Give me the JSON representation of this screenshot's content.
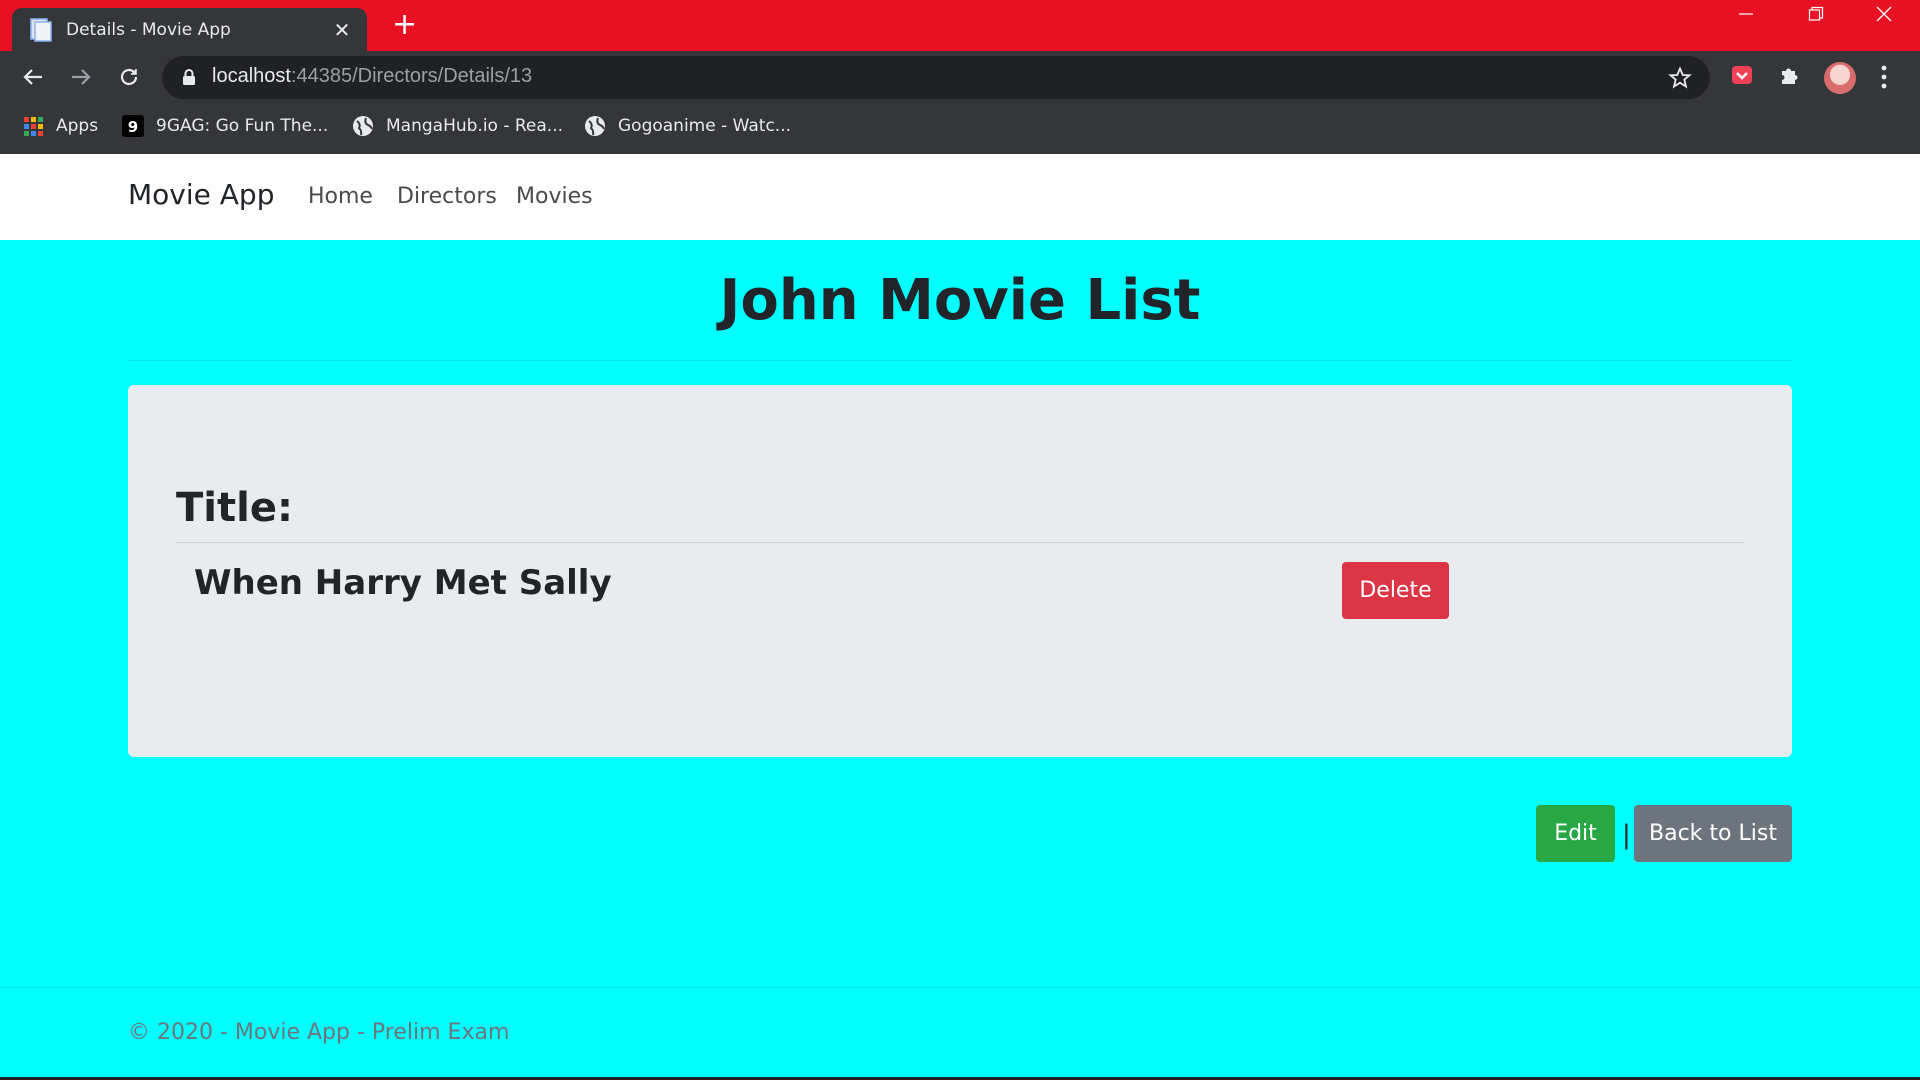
{
  "browser": {
    "tab_title": "Details - Movie App",
    "tab_close": "✕",
    "new_tab": "+",
    "url_host": "localhost",
    "url_rest": ":44385/Directors/Details/13",
    "bookmarks": [
      {
        "label": "Apps"
      },
      {
        "label": "9GAG: Go Fun The..."
      },
      {
        "label": "MangaHub.io - Rea..."
      },
      {
        "label": "Gogoanime - Watc..."
      }
    ]
  },
  "navbar": {
    "brand": "Movie App",
    "links": [
      "Home",
      "Directors",
      "Movies"
    ]
  },
  "page": {
    "heading": "John Movie List",
    "title_label": "Title:",
    "movie_title": "When Harry Met Sally",
    "delete_label": "Delete",
    "edit_label": "Edit",
    "separator": "|",
    "back_label": "Back to List"
  },
  "footer": {
    "text": "© 2020 - Movie App - Prelim Exam"
  },
  "colors": {
    "page_background": "#00ffff",
    "tabstrip": "#e81123",
    "delete": "#dc3545",
    "edit": "#28a745",
    "back": "#6c757d"
  },
  "icons": [
    "page-icon",
    "back-arrow-icon",
    "forward-arrow-icon",
    "reload-icon",
    "lock-icon",
    "star-icon",
    "pocket-icon",
    "puzzle-icon",
    "apps-icon",
    "globe-icon"
  ]
}
